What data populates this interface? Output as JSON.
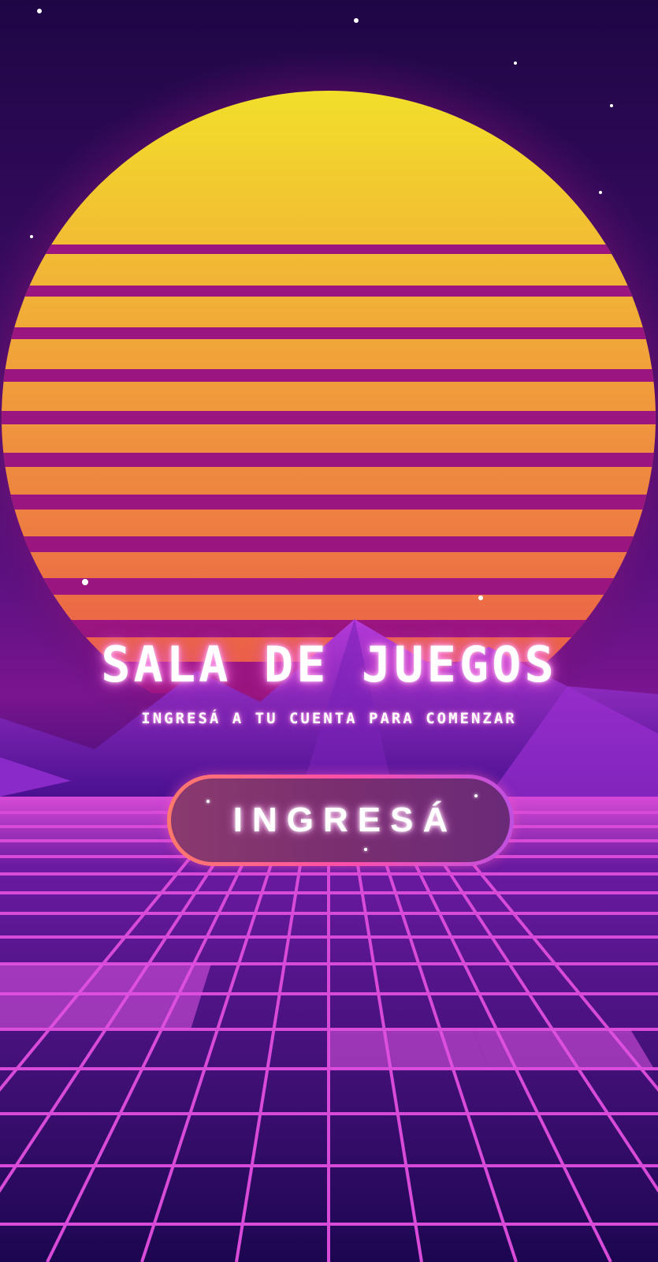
{
  "app": {
    "title": "SALA DE JUEGOS",
    "subtitle": "INGRESÁ A TU CUENTA PARA COMENZAR"
  },
  "actions": {
    "enter_label": "INGRESÁ"
  },
  "colors": {
    "sun_top": "#f2e02a",
    "sun_bottom": "#ea5a4a",
    "grid_line": "#d84ad8",
    "sky": "#2a0a4e",
    "button_border_start": "#ff7a6a",
    "button_border_end": "#c050e0"
  },
  "icons": {
    "background": "synthwave-sunset-illustration"
  }
}
